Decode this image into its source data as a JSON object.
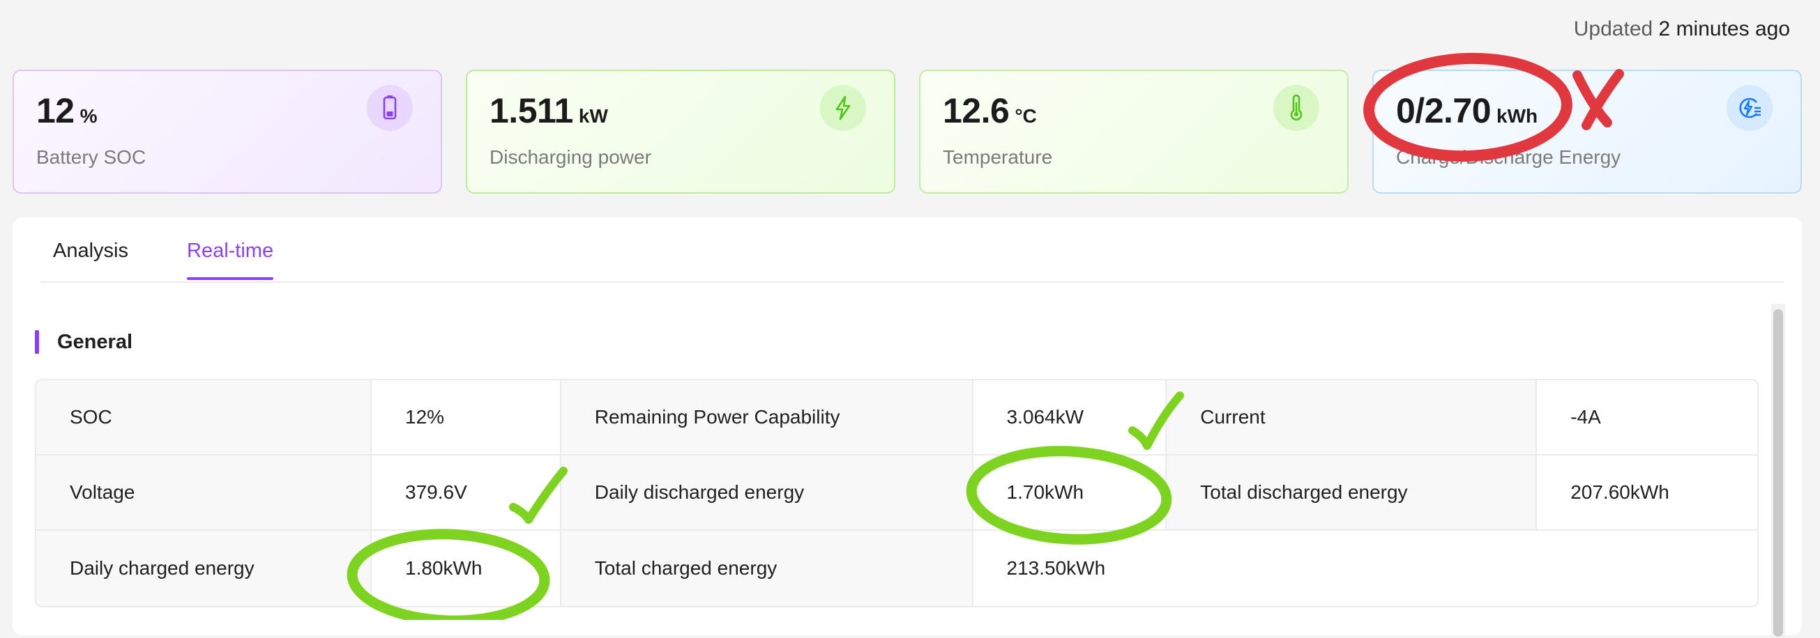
{
  "header": {
    "updated_prefix": "Updated",
    "updated_ago": "2 minutes ago"
  },
  "cards": [
    {
      "value": "12",
      "unit": "%",
      "label": "Battery SOC",
      "icon": "battery-icon",
      "accent": "#8a3ffc"
    },
    {
      "value": "1.511",
      "unit": "kW",
      "label": "Discharging power",
      "icon": "lightning-icon",
      "accent": "#52c41a"
    },
    {
      "value": "12.6",
      "unit": "°C",
      "label": "Temperature",
      "icon": "thermometer-icon",
      "accent": "#52c41a"
    },
    {
      "value": "0/2.70",
      "unit": "kWh",
      "label": "Charge/Discharge Energy",
      "icon": "energy-icon",
      "accent": "#1677ff"
    }
  ],
  "tabs": [
    {
      "label": "Analysis",
      "active": false
    },
    {
      "label": "Real-time",
      "active": true
    }
  ],
  "section": {
    "title": "General",
    "accent": "#8a3ffc"
  },
  "table": {
    "rows": [
      [
        {
          "k": "SOC",
          "v": "12%"
        },
        {
          "k": "Remaining Power Capability",
          "v": "3.064kW"
        },
        {
          "k": "Current",
          "v": "-4A"
        }
      ],
      [
        {
          "k": "Voltage",
          "v": "379.6V"
        },
        {
          "k": "Daily discharged energy",
          "v": "1.70kWh"
        },
        {
          "k": "Total discharged energy",
          "v": "207.60kWh"
        }
      ],
      [
        {
          "k": "Daily charged energy",
          "v": "1.80kWh"
        },
        {
          "k": "Total charged energy",
          "v": "213.50kWh"
        }
      ]
    ]
  },
  "annotations": {
    "cross_color": "#e0383e",
    "check_color": "#7ed321"
  }
}
